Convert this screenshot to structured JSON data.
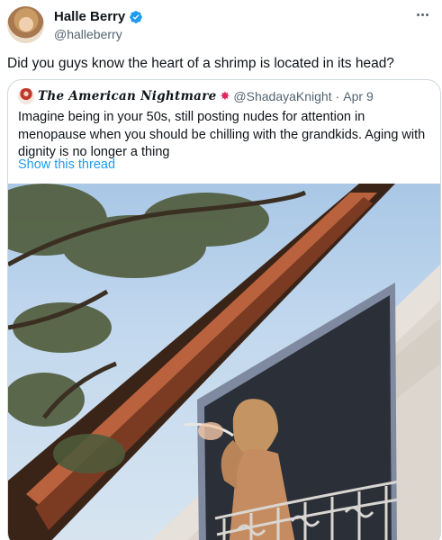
{
  "author": {
    "display_name": "Halle Berry",
    "handle": "@halleberry",
    "avatar_icon": "avatar-photo",
    "verified_icon": "verified-badge-icon",
    "verified_color": "#1d9bf0"
  },
  "tweet": {
    "text": "Did you guys know the heart of a shrimp is located in its head?"
  },
  "quoted_tweet": {
    "display_name": "𝑻𝒉𝒆 𝑨𝒎𝒆𝒓𝒊𝒄𝒂𝒏 𝑵𝒊𝒈𝒉𝒕𝒎𝒂𝒓𝒆",
    "name_emoji": "✸",
    "handle": "@ShadayaKnight",
    "separator": "·",
    "date": "Apr 9",
    "text": "Imagine being in your 50s, still posting nudes for attention in menopause when you should be chilling with the grandkids. Aging with dignity is no longer a thing",
    "show_thread_label": "Show this thread",
    "link_color": "#1d9bf0"
  },
  "colors": {
    "primary_text": "#0f1419",
    "secondary_text": "#536471",
    "border": "#cfd9de"
  }
}
